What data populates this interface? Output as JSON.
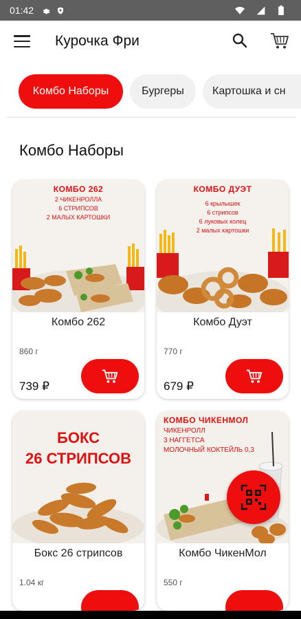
{
  "status_bar": {
    "time": "01:42"
  },
  "app_bar": {
    "title": "Курочка Фри"
  },
  "categories": [
    {
      "label": "Комбо Наборы"
    },
    {
      "label": "Бургеры"
    },
    {
      "label": "Картошка и сн"
    }
  ],
  "section": {
    "title": "Комбо Наборы"
  },
  "products": [
    {
      "name": "Комбо 262",
      "weight": "860 г",
      "price": "739 ₽",
      "photo_title": "КОМБО 262",
      "photo_lines": [
        "2 ЧИКЕНРОЛЛА",
        "6 СТРИПСОВ",
        "2 МАЛЫХ КАРТОШКИ"
      ]
    },
    {
      "name": "Комбо Дуэт",
      "weight": "770 г",
      "price": "679 ₽",
      "photo_title": "КОМБО ДУЭТ",
      "photo_lines": [
        "6 крылышек",
        "6 стрипсов",
        "6 луковых колец",
        "2 малых картошки"
      ]
    },
    {
      "name": "Бокс 26 стрипсов",
      "weight": "1.04 кг",
      "photo_big1": "БОКС",
      "photo_big2": "26 СТРИПСОВ"
    },
    {
      "name": "Комбо ЧикенМол",
      "weight": "550 г",
      "photo_title": "КОМБО ЧИКЕНМОЛ",
      "photo_lines": [
        "ЧИКЕНРОЛЛ",
        "3 НАГГЕТСА",
        "МОЛОЧНЫЙ КОКТЕЙЛЬ 0,3"
      ]
    }
  ],
  "colors": {
    "accent": "#ee0e0e",
    "status_bar": "#5f5f5f"
  },
  "icons": [
    "menu-icon",
    "search-icon",
    "cart-icon",
    "add-to-cart-icon",
    "qr-code-icon"
  ]
}
